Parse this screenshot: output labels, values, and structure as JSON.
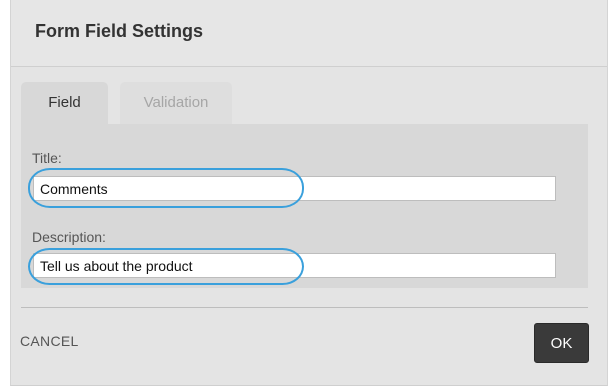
{
  "dialog": {
    "title": "Form Field Settings"
  },
  "tabs": [
    {
      "label": "Field",
      "active": true
    },
    {
      "label": "Validation",
      "active": false
    }
  ],
  "fields": {
    "title": {
      "label": "Title:",
      "value": "Comments"
    },
    "description": {
      "label": "Description:",
      "value": "Tell us about the product"
    }
  },
  "actions": {
    "cancel_label": "CANCEL",
    "ok_label": "OK"
  },
  "colors": {
    "dialog_bg": "#e4e4e4",
    "panel_bg": "#d8d8d8",
    "highlight": "#3aa0dc",
    "ok_button": "#3a3a3a"
  }
}
